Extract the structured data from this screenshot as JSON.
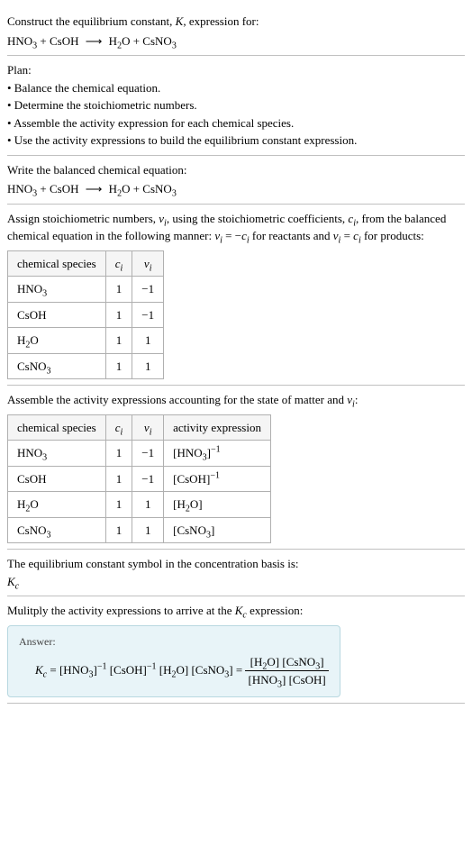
{
  "header": {
    "prompt": "Construct the equilibrium constant, ",
    "kvar": "K",
    "prompt2": ", expression for:",
    "equation_lhs1": "HNO",
    "equation_lhs1_sub": "3",
    "plus": " + ",
    "equation_lhs2": "CsOH",
    "arrow": "⟶",
    "equation_rhs1": "H",
    "equation_rhs1_sub": "2",
    "equation_rhs1b": "O",
    "equation_rhs2": "CsNO",
    "equation_rhs2_sub": "3"
  },
  "plan": {
    "title": "Plan:",
    "b1": "• Balance the chemical equation.",
    "b2": "• Determine the stoichiometric numbers.",
    "b3": "• Assemble the activity expression for each chemical species.",
    "b4": "• Use the activity expressions to build the equilibrium constant expression."
  },
  "balanced": {
    "title": "Write the balanced chemical equation:"
  },
  "stoich": {
    "text1": "Assign stoichiometric numbers, ",
    "nu": "ν",
    "isub": "i",
    "text2": ", using the stoichiometric coefficients, ",
    "c": "c",
    "text3": ", from the balanced chemical equation in the following manner: ",
    "eq1a": "ν",
    "eq1b": " = −",
    "eq1c": "c",
    "text4": " for reactants and ",
    "eq2a": "ν",
    "eq2b": " = ",
    "eq2c": "c",
    "text5": " for products:",
    "h1": "chemical species",
    "h2": "c",
    "h3": "ν",
    "rows": [
      {
        "sp_a": "HNO",
        "sp_sub": "3",
        "sp_b": "",
        "c": "1",
        "nu": "−1"
      },
      {
        "sp_a": "CsOH",
        "sp_sub": "",
        "sp_b": "",
        "c": "1",
        "nu": "−1"
      },
      {
        "sp_a": "H",
        "sp_sub": "2",
        "sp_b": "O",
        "c": "1",
        "nu": "1"
      },
      {
        "sp_a": "CsNO",
        "sp_sub": "3",
        "sp_b": "",
        "c": "1",
        "nu": "1"
      }
    ]
  },
  "activity": {
    "text1": "Assemble the activity expressions accounting for the state of matter and ",
    "nu": "ν",
    "isub": "i",
    "colon": ":",
    "h1": "chemical species",
    "h2": "c",
    "h3": "ν",
    "h4": "activity expression",
    "rows": [
      {
        "sp_a": "HNO",
        "sp_sub": "3",
        "sp_b": "",
        "c": "1",
        "nu": "−1",
        "ae_a": "[HNO",
        "ae_sub": "3",
        "ae_b": "]",
        "ae_sup": "−1"
      },
      {
        "sp_a": "CsOH",
        "sp_sub": "",
        "sp_b": "",
        "c": "1",
        "nu": "−1",
        "ae_a": "[CsOH",
        "ae_sub": "",
        "ae_b": "]",
        "ae_sup": "−1"
      },
      {
        "sp_a": "H",
        "sp_sub": "2",
        "sp_b": "O",
        "c": "1",
        "nu": "1",
        "ae_a": "[H",
        "ae_sub": "2",
        "ae_b": "O]",
        "ae_sup": ""
      },
      {
        "sp_a": "CsNO",
        "sp_sub": "3",
        "sp_b": "",
        "c": "1",
        "nu": "1",
        "ae_a": "[CsNO",
        "ae_sub": "3",
        "ae_b": "]",
        "ae_sup": ""
      }
    ]
  },
  "kc_symbol": {
    "text": "The equilibrium constant symbol in the concentration basis is:",
    "kc_k": "K",
    "kc_c": "c"
  },
  "multiply": {
    "text1": "Mulitply the activity expressions to arrive at the ",
    "kc_k": "K",
    "kc_c": "c",
    "text2": " expression:"
  },
  "answer": {
    "label": "Answer:",
    "kc_k": "K",
    "kc_c": "c",
    "eq": " = ",
    "t1a": "[HNO",
    "t1sub": "3",
    "t1b": "]",
    "t1sup": "−1",
    "sp": " ",
    "t2a": "[CsOH]",
    "t2sup": "−1",
    "t3a": "[H",
    "t3sub": "2",
    "t3b": "O]",
    "t4a": "[CsNO",
    "t4sub": "3",
    "t4b": "]",
    "eq2": " = ",
    "num1a": "[H",
    "num1sub": "2",
    "num1b": "O]",
    "num2a": "[CsNO",
    "num2sub": "3",
    "num2b": "]",
    "den1a": "[HNO",
    "den1sub": "3",
    "den1b": "]",
    "den2a": "[CsOH]"
  }
}
